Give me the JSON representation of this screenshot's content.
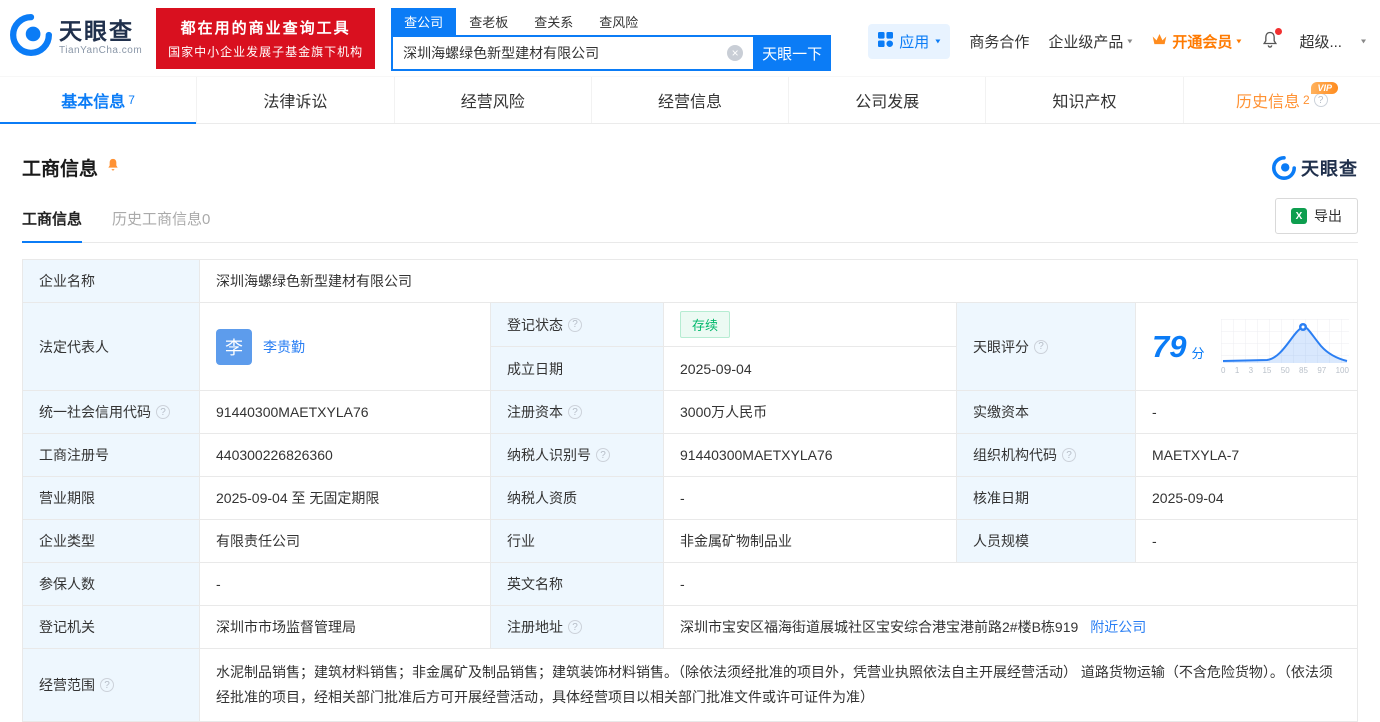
{
  "header": {
    "logo": {
      "name": "天眼查",
      "domain": "TianYanCha.com"
    },
    "promo": {
      "line1": "都在用的商业查询工具",
      "line2": "国家中小企业发展子基金旗下机构"
    },
    "search": {
      "tabs": [
        {
          "label": "查公司",
          "active": true
        },
        {
          "label": "查老板",
          "active": false
        },
        {
          "label": "查关系",
          "active": false
        },
        {
          "label": "查风险",
          "active": false
        }
      ],
      "value": "深圳海螺绿色新型建材有限公司",
      "button": "天眼一下"
    },
    "nav": {
      "apps": "应用",
      "cooperation": "商务合作",
      "enterprise": "企业级产品",
      "vip": "开通会员",
      "user": "超级..."
    }
  },
  "tabs": [
    {
      "label": "基本信息",
      "badge": "7"
    },
    {
      "label": "法律诉讼",
      "badge": ""
    },
    {
      "label": "经营风险",
      "badge": ""
    },
    {
      "label": "经营信息",
      "badge": ""
    },
    {
      "label": "公司发展",
      "badge": ""
    },
    {
      "label": "知识产权",
      "badge": ""
    },
    {
      "label": "历史信息",
      "badge": "2",
      "vip_tag": "VIP"
    }
  ],
  "section": {
    "title": "工商信息",
    "brand": "天眼查",
    "subtabs": [
      {
        "label": "工商信息"
      },
      {
        "label": "历史工商信息0"
      }
    ],
    "export_label": "导出"
  },
  "info": {
    "company_name": {
      "label": "企业名称",
      "value": "深圳海螺绿色新型建材有限公司"
    },
    "legal_rep": {
      "label": "法定代表人",
      "avatar": "李",
      "value": "李贵勤"
    },
    "reg_status": {
      "label": "登记状态",
      "value": "存续"
    },
    "establish_date": {
      "label": "成立日期",
      "value": "2025-09-04"
    },
    "score": {
      "label": "天眼评分",
      "value": "79",
      "unit": "分",
      "axis": [
        "0",
        "1",
        "3",
        "15",
        "50",
        "85",
        "97",
        "100"
      ]
    },
    "credit_code": {
      "label": "统一社会信用代码",
      "value": "91440300MAETXYLA76"
    },
    "reg_capital": {
      "label": "注册资本",
      "value": "3000万人民币"
    },
    "paid_capital": {
      "label": "实缴资本",
      "value": "-"
    },
    "reg_number": {
      "label": "工商注册号",
      "value": "440300226826360"
    },
    "taxpayer_id": {
      "label": "纳税人识别号",
      "value": "91440300MAETXYLA76"
    },
    "org_code": {
      "label": "组织机构代码",
      "value": "MAETXYLA-7"
    },
    "business_term": {
      "label": "营业期限",
      "value": "2025-09-04 至 无固定期限"
    },
    "taxpayer_quality": {
      "label": "纳税人资质",
      "value": "-"
    },
    "approval_date": {
      "label": "核准日期",
      "value": "2025-09-04"
    },
    "company_type": {
      "label": "企业类型",
      "value": "有限责任公司"
    },
    "industry": {
      "label": "行业",
      "value": "非金属矿物制品业"
    },
    "staff_size": {
      "label": "人员规模",
      "value": "-"
    },
    "insured_count": {
      "label": "参保人数",
      "value": "-"
    },
    "english_name": {
      "label": "英文名称",
      "value": "-"
    },
    "reg_authority": {
      "label": "登记机关",
      "value": "深圳市市场监督管理局"
    },
    "reg_address": {
      "label": "注册地址",
      "value": "深圳市宝安区福海街道展城社区宝安综合港宝港前路2#楼B栋919",
      "link": "附近公司"
    },
    "business_scope": {
      "label": "经营范围",
      "value": "水泥制品销售；建筑材料销售；非金属矿及制品销售；建筑装饰材料销售。（除依法须经批准的项目外，凭营业执照依法自主开展经营活动） 道路货物运输（不含危险货物）。（依法须经批准的项目，经相关部门批准后方可开展经营活动，具体经营项目以相关部门批准文件或许可证件为准）"
    }
  },
  "icons": {
    "logo": "eye-swirl",
    "app_grid": "grid",
    "bell": "bell",
    "crown": "crown",
    "clear": "×",
    "excel": "X",
    "help": "?",
    "caret": "▾"
  },
  "colors": {
    "brand_blue": "#0b7cf6",
    "link_blue": "#2b7ff3",
    "promo_red": "#d9101f",
    "vip_orange": "#ff7a00",
    "history_orange": "#ff9234",
    "status_green": "#00b86b",
    "label_bg": "#eef7fe"
  }
}
